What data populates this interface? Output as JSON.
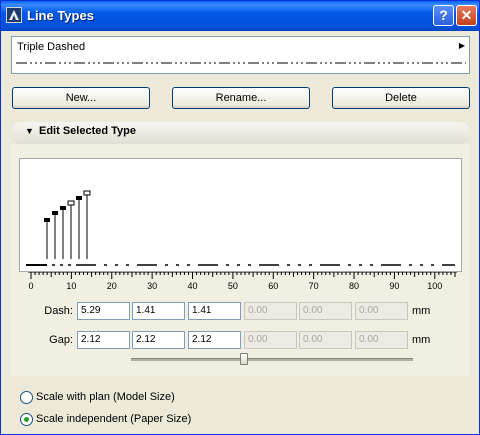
{
  "window": {
    "title": "Line Types",
    "help_glyph": "?",
    "close_glyph": "✕"
  },
  "line_type": {
    "name": "Triple Dashed"
  },
  "buttons": {
    "new": "New...",
    "rename": "Rename...",
    "delete": "Delete"
  },
  "section": {
    "title": "Edit Selected Type"
  },
  "ruler": {
    "ticks": [
      "0",
      "10",
      "20",
      "30",
      "40",
      "50",
      "60",
      "70",
      "80",
      "90",
      "100"
    ]
  },
  "dash": {
    "label": "Dash:",
    "values": [
      "5.29",
      "1.41",
      "1.41"
    ],
    "disabled_values": [
      "0.00",
      "0.00",
      "0.00"
    ],
    "unit": "mm"
  },
  "gap": {
    "label": "Gap:",
    "values": [
      "2.12",
      "2.12",
      "2.12"
    ],
    "disabled_values": [
      "0.00",
      "0.00",
      "0.00"
    ],
    "unit": "mm"
  },
  "scale_slider": {
    "level": 0.4
  },
  "scale_options": [
    {
      "label": "Scale with plan (Model Size)",
      "selected": false
    },
    {
      "label": "Scale independent (Paper Size)",
      "selected": true
    }
  ],
  "colors": {
    "title_bar": "#0058e8",
    "dialog_bg": "#ece9d8",
    "radio_dot": "#21a121"
  }
}
